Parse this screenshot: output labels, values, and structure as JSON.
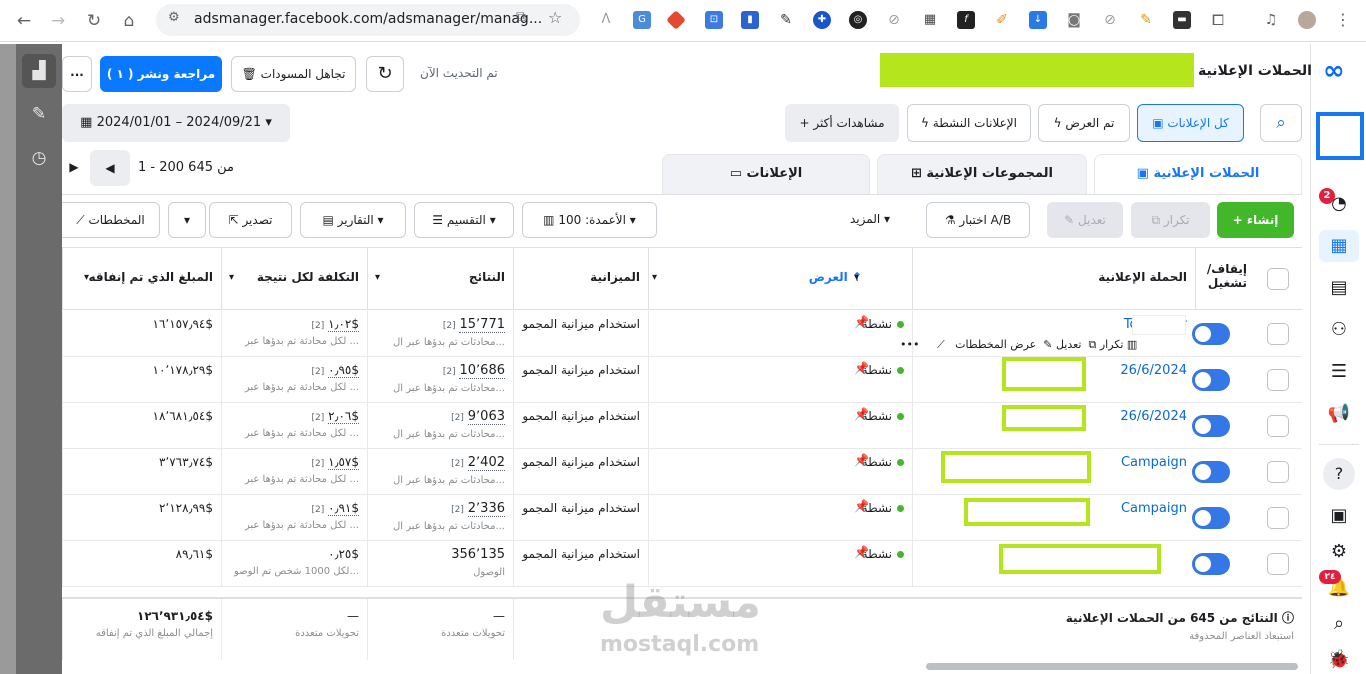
{
  "browser": {
    "url": "adsmanager.facebook.com/adsmanager/manag...",
    "page_title": "الحملات الإعلانية"
  },
  "header": {
    "update_status": "تم التحديث الآن",
    "discard_label": "تجاهل المسودات",
    "review_label": "مراجعة ونشر ( ١ )",
    "more": "..."
  },
  "filters": {
    "all_ads": "كل الإعلانات",
    "delivered": "تم العرض",
    "active_ads": "الإعلانات النشطة",
    "more_views": "مشاهدات أكثر",
    "date_range": "2024/01/01 – 2024/09/21"
  },
  "pagination": {
    "range": "1 - 200 من 645"
  },
  "tabs": [
    {
      "label": "الحملات الإعلانية"
    },
    {
      "label": "المجموعات الإعلانية"
    },
    {
      "label": "الإعلانات"
    }
  ],
  "toolbar": {
    "create": "إنشاء",
    "duplicate": "تكرار",
    "edit": "تعديل",
    "ab_test": "اختبار A/B",
    "more": "المزيد",
    "columns": "الأعمدة: 100",
    "breakdown": "التقسيم",
    "reports": "التقارير",
    "export": "تصدير",
    "charts": "المخططات"
  },
  "columns": {
    "toggle": "إيقاف/ تشغيل",
    "campaign": "الحملة الإعلانية",
    "delivery": "العرض",
    "budget": "الميزانية",
    "results": "النتائج",
    "cost_per_result": "التكلفة لكل نتيجة",
    "amount_spent": "المبلغ الذي تم إنفاقه"
  },
  "row_actions": {
    "view_charts": "عرض المخططات",
    "edit": "تعديل",
    "duplicate": "تكرار",
    "more": "•••"
  },
  "rows": [
    {
      "name": "Top | Funr",
      "delivery": "نشطة",
      "budget": "استخدام ميزانية المجمو",
      "results": "15٬771",
      "results_sub": "محادثات تم بدؤها عبر ال...",
      "cpr": "١٫٠٢$",
      "cpr_sub": "لكل محادثة تم بدؤها عبر ...",
      "spent": "١٦٬١٥٧٫٩٤$"
    },
    {
      "name": "26/6/2024",
      "delivery": "نشطة",
      "budget": "استخدام ميزانية المجمو",
      "results": "10٬686",
      "results_sub": "محادثات تم بدؤها عبر ال...",
      "cpr": "٠٫٩٥$",
      "cpr_sub": "لكل محادثة تم بدؤها عبر ...",
      "spent": "١٠٬١٧٨٫٢٩$"
    },
    {
      "name": "26/6/2024",
      "delivery": "نشطة",
      "budget": "استخدام ميزانية المجمو",
      "results": "9٬063",
      "results_sub": "محادثات تم بدؤها عبر ال...",
      "cpr": "٢٫٠٦$",
      "cpr_sub": "لكل محادثة تم بدؤها عبر ...",
      "spent": "١٨٬٦٨١٫٥٤$"
    },
    {
      "name": "Campaign",
      "delivery": "نشطة",
      "budget": "استخدام ميزانية المجمو",
      "results": "2٬402",
      "results_sub": "محادثات تم بدؤها عبر ال...",
      "cpr": "١٫٥٧$",
      "cpr_sub": "لكل محادثة تم بدؤها عبر ...",
      "spent": "٣٬٧٦٣٫٧٤$"
    },
    {
      "name": "Campaign",
      "delivery": "نشطة",
      "budget": "استخدام ميزانية المجمو",
      "results": "2٬336",
      "results_sub": "محادثات تم بدؤها عبر ال...",
      "cpr": "٠٫٩١$",
      "cpr_sub": "لكل محادثة تم بدؤها عبر ...",
      "spent": "٢٬١٢٨٫٩٩$"
    },
    {
      "name": "",
      "delivery": "نشطة",
      "budget": "استخدام ميزانية المجمو",
      "results": "356٬135",
      "results_sub": "الوصول",
      "cpr": "٠٫٢٥$",
      "cpr_sub": "لكل 1000 شخص تم الوصو...",
      "spent": "٨٩٫٦١$"
    }
  ],
  "totals": {
    "title": "النتائج من 645 من الحملات الإعلانية",
    "subtitle": "استبعاد العناصر المحذوفة",
    "results": "—",
    "results_sub": "تحويلات متعددة",
    "cpr": "—",
    "cpr_sub": "تحويلات متعددة",
    "spent": "١٢٦٬٩٣١٫٥٤$",
    "spent_sub": "إجمالي المبلغ الذي تم إنفاقه"
  },
  "badges": {
    "notifications": "2",
    "alerts": "٢٤"
  },
  "watermark": {
    "line1": "مستقل",
    "line2": "mostaql.com"
  }
}
